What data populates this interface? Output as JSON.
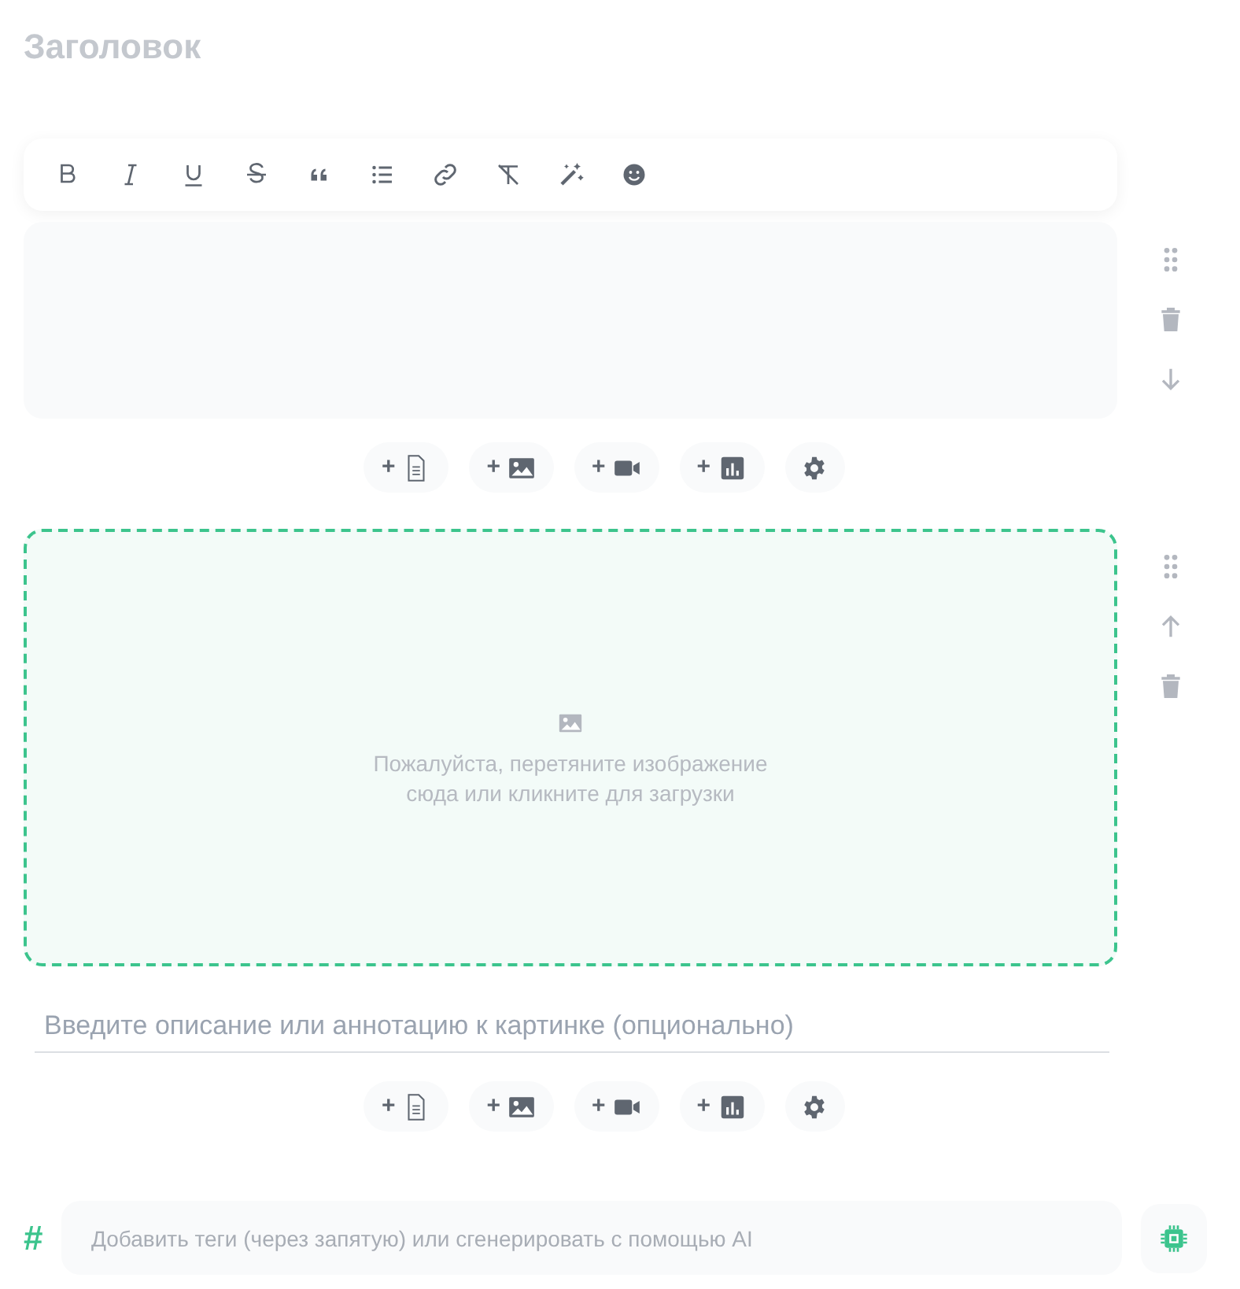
{
  "title": {
    "placeholder": "Заголовок"
  },
  "toolbar": [
    {
      "kind": "bold"
    },
    {
      "kind": "italic"
    },
    {
      "kind": "underline"
    },
    {
      "kind": "strike"
    },
    {
      "kind": "quote"
    },
    {
      "kind": "list"
    },
    {
      "kind": "link"
    },
    {
      "kind": "clear"
    },
    {
      "kind": "magic"
    },
    {
      "kind": "emoji"
    }
  ],
  "blocks": [
    {
      "kind": "text",
      "actions": [
        {
          "kind": "drag"
        },
        {
          "kind": "delete"
        },
        {
          "kind": "down"
        }
      ],
      "insert": [
        {
          "label": "+",
          "kind": "document"
        },
        {
          "label": "+",
          "kind": "image"
        },
        {
          "label": "+",
          "kind": "video"
        },
        {
          "label": "+",
          "kind": "chart"
        },
        {
          "kind": "settings"
        }
      ]
    },
    {
      "kind": "image",
      "drop_text": "Пожалуйста, перетяните изображение сюда или кликните для загрузки",
      "caption": {
        "placeholder": "Введите описание или аннотацию к картинке (опционально)"
      },
      "actions": [
        {
          "kind": "drag"
        },
        {
          "kind": "up"
        },
        {
          "kind": "delete"
        }
      ],
      "insert": [
        {
          "label": "+",
          "kind": "document"
        },
        {
          "label": "+",
          "kind": "image"
        },
        {
          "label": "+",
          "kind": "video"
        },
        {
          "label": "+",
          "kind": "chart"
        },
        {
          "kind": "settings"
        }
      ]
    }
  ],
  "tags": {
    "symbol": "#",
    "placeholder": "Добавить теги (через запятую) или сгенерировать с помощью AI"
  }
}
